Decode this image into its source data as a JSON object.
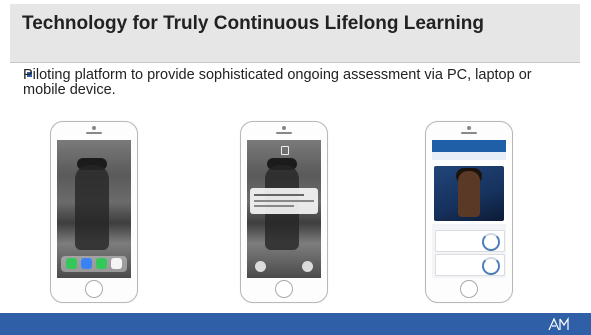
{
  "slide": {
    "title": "Technology for Truly Continuous Lifelong Learning",
    "bullet": "Piloting platform to provide sophisticated ongoing assessment via PC, laptop or mobile device."
  },
  "colors": {
    "title_bg": "#e6e6e6",
    "footer": "#2f5fa6",
    "app_bar": "#1f5fa8"
  },
  "phones": [
    {
      "label": "home-screen"
    },
    {
      "label": "lock-screen-notification"
    },
    {
      "label": "app-screen"
    }
  ]
}
